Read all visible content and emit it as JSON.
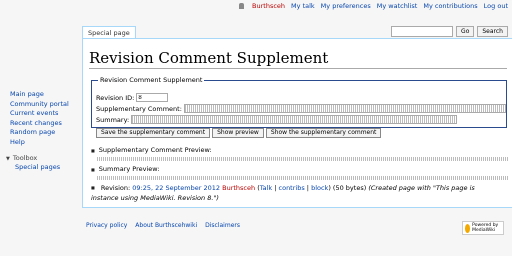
{
  "personal": {
    "username": "Burthsceh",
    "talk": "My talk",
    "preferences": "My preferences",
    "watchlist": "My watchlist",
    "contributions": "My contributions",
    "logout": "Log out"
  },
  "tabs": {
    "special_page": "Special page"
  },
  "search": {
    "placeholder": "",
    "go": "Go",
    "search": "Search"
  },
  "page": {
    "title": "Revision Comment Supplement"
  },
  "form": {
    "legend": "Revision Comment Supplement",
    "revision_id_label": "Revision ID:",
    "revision_id_value": "8",
    "supplementary_label": "Supplementary Comment:",
    "summary_label": "Summary:",
    "btn_save": "Save the supplementary comment",
    "btn_preview": "Show preview",
    "btn_show": "Show the supplementary comment"
  },
  "preview": {
    "supplementary_label": "Supplementary Comment Preview:",
    "summary_label": "Summary Preview:"
  },
  "revision": {
    "prefix": "Revision:",
    "timestamp": "09:25, 22 September 2012",
    "user": "Burthsceh",
    "talk": "Talk",
    "contribs": "contribs",
    "block": "block",
    "bytes": "(50 bytes)",
    "comment": "(Created page with \"This page is instance using MediaWiki. Revision 8.\")"
  },
  "sidebar": {
    "items": [
      "Main page",
      "Community portal",
      "Current events",
      "Recent changes",
      "Random page",
      "Help"
    ],
    "toolbox_label": "Toolbox",
    "toolbox_items": [
      "Special pages"
    ]
  },
  "footer": {
    "privacy": "Privacy policy",
    "about": "About Burthscehwiki",
    "disclaimers": "Disclaimers",
    "powered": "Powered by MediaWiki"
  }
}
